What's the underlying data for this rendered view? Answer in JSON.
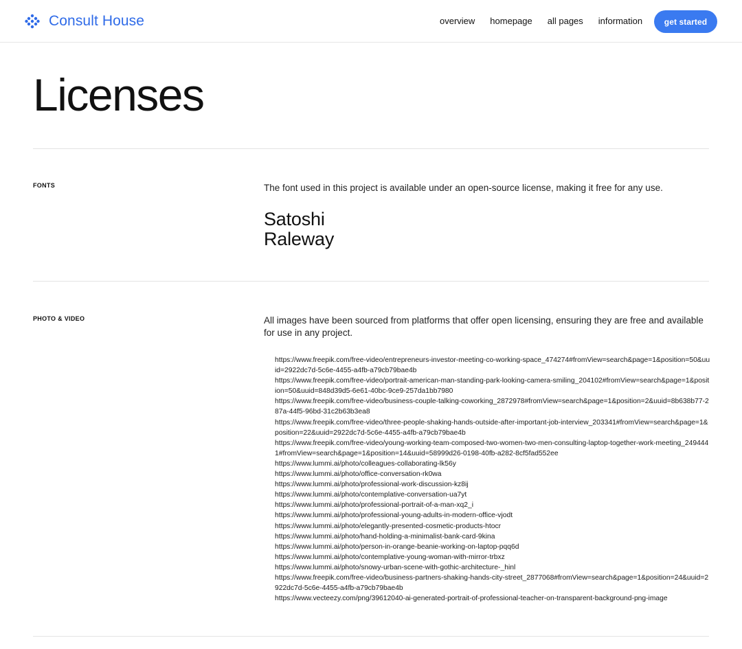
{
  "header": {
    "logo_text": "Consult House",
    "logo_icon": "dots-cluster-icon",
    "nav": [
      "overview",
      "homepage",
      "all pages",
      "information"
    ],
    "cta_label": "get started",
    "accent_color": "#3a7af0"
  },
  "page": {
    "title": "Licenses"
  },
  "sections": {
    "fonts": {
      "label": "FONTS",
      "description": "The font used in this project is available under an open-source license, making it free for any use.",
      "fonts": [
        "Satoshi",
        "Raleway"
      ]
    },
    "photo_video": {
      "label": "PHOTO & VIDEO",
      "description": "All images have been sourced from platforms that offer open licensing, ensuring they are free and available for use in any project.",
      "links": [
        "https://www.freepik.com/free-video/entrepreneurs-investor-meeting-co-working-space_474274#fromView=search&page=1&position=50&uuid=2922dc7d-5c6e-4455-a4fb-a79cb79bae4b",
        "https://www.freepik.com/free-video/portrait-american-man-standing-park-looking-camera-smiling_204102#fromView=search&page=1&position=50&uuid=848d39d5-6e61-40bc-9ce9-257da1bb7980",
        "https://www.freepik.com/free-video/business-couple-talking-coworking_2872978#fromView=search&page=1&position=2&uuid=8b638b77-287a-44f5-96bd-31c2b63b3ea8",
        "https://www.freepik.com/free-video/three-people-shaking-hands-outside-after-important-job-interview_203341#fromView=search&page=1&position=22&uuid=2922dc7d-5c6e-4455-a4fb-a79cb79bae4b",
        "https://www.freepik.com/free-video/young-working-team-composed-two-women-two-men-consulting-laptop-together-work-meeting_2494441#fromView=search&page=1&position=14&uuid=58999d26-0198-40fb-a282-8cf5fad552ee",
        "https://www.lummi.ai/photo/colleagues-collaborating-lk56y",
        "https://www.lummi.ai/photo/office-conversation-rk0wa",
        "https://www.lummi.ai/photo/professional-work-discussion-kz8ij",
        "https://www.lummi.ai/photo/contemplative-conversation-ua7yt",
        "https://www.lummi.ai/photo/professional-portrait-of-a-man-xq2_i",
        "https://www.lummi.ai/photo/professional-young-adults-in-modern-office-vjodt",
        "https://www.lummi.ai/photo/elegantly-presented-cosmetic-products-htocr",
        "https://www.lummi.ai/photo/hand-holding-a-minimalist-bank-card-9kina",
        "https://www.lummi.ai/photo/person-in-orange-beanie-working-on-laptop-pqq6d",
        "https://www.lummi.ai/photo/contemplative-young-woman-with-mirror-trbxz",
        "https://www.lummi.ai/photo/snowy-urban-scene-with-gothic-architecture-_hinl",
        "https://www.freepik.com/free-video/business-partners-shaking-hands-city-street_2877068#fromView=search&page=1&position=24&uuid=2922dc7d-5c6e-4455-a4fb-a79cb79bae4b",
        "https://www.vecteezy.com/png/39612040-ai-generated-portrait-of-professional-teacher-on-transparent-background-png-image"
      ]
    }
  }
}
